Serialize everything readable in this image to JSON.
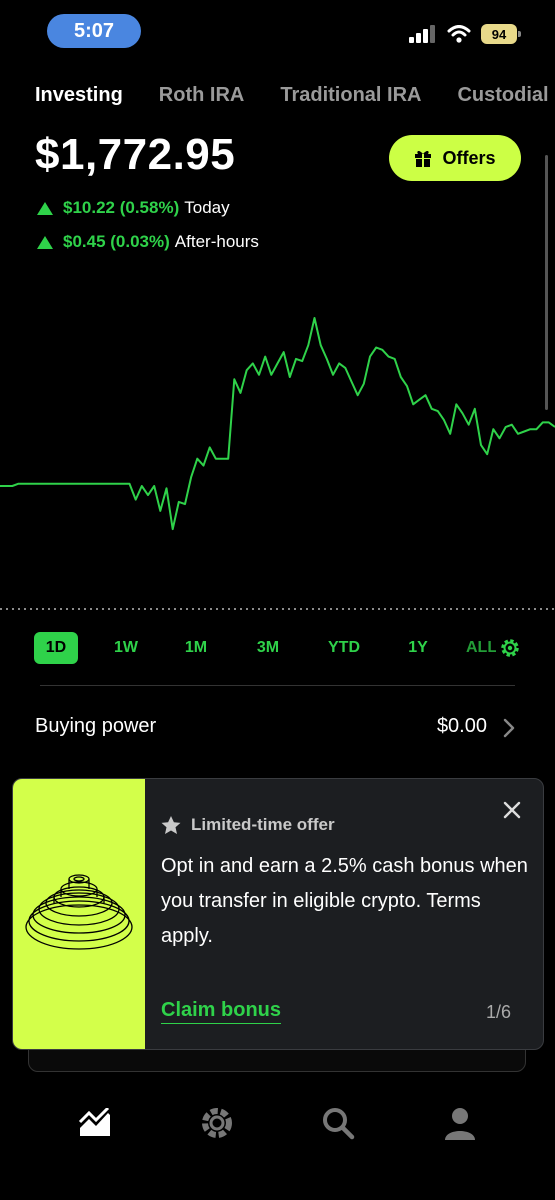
{
  "status": {
    "time": "5:07",
    "battery": "94"
  },
  "tabs": [
    "Investing",
    "Roth IRA",
    "Traditional IRA",
    "Custodial"
  ],
  "portfolio": {
    "balance": "$1,772.95",
    "today_change": "$10.22 (0.58%)",
    "today_label": "Today",
    "afterhours_change": "$0.45 (0.03%)",
    "afterhours_label": "After-hours"
  },
  "offers_button": {
    "label": "Offers",
    "icon": "gift-icon"
  },
  "chart_data": {
    "type": "line",
    "color": "#2fd24a",
    "reference_line": "dotted",
    "series": [
      {
        "values": [
          0.26,
          0.26,
          0.26,
          0.27,
          0.27,
          0.27,
          0.27,
          0.27,
          0.27,
          0.27,
          0.27,
          0.27,
          0.27,
          0.27,
          0.27,
          0.27,
          0.27,
          0.27,
          0.27,
          0.27,
          0.27,
          0.27,
          0.2,
          0.26,
          0.22,
          0.26,
          0.15,
          0.25,
          0.07,
          0.19,
          0.18,
          0.3,
          0.38,
          0.35,
          0.43,
          0.38,
          0.38,
          0.38,
          0.73,
          0.67,
          0.77,
          0.8,
          0.75,
          0.83,
          0.75,
          0.8,
          0.85,
          0.74,
          0.82,
          0.81,
          0.88,
          1.0,
          0.88,
          0.82,
          0.75,
          0.8,
          0.78,
          0.72,
          0.66,
          0.71,
          0.83,
          0.87,
          0.86,
          0.83,
          0.82,
          0.74,
          0.7,
          0.62,
          0.64,
          0.66,
          0.6,
          0.59,
          0.55,
          0.49,
          0.62,
          0.58,
          0.53,
          0.6,
          0.44,
          0.4,
          0.51,
          0.47,
          0.52,
          0.53,
          0.49,
          0.5,
          0.51,
          0.51,
          0.54,
          0.54,
          0.52
        ]
      }
    ]
  },
  "ranges": {
    "items": [
      "1D",
      "1W",
      "1M",
      "3M",
      "YTD",
      "1Y",
      "ALL"
    ],
    "selected": "1D",
    "settings_icon": "gear-icon"
  },
  "buying_power": {
    "label": "Buying power",
    "value": "$0.00"
  },
  "promo": {
    "tag": "Limited-time offer",
    "body": "Opt in and earn a 2.5% cash bonus when you transfer in eligible crypto. Terms apply.",
    "cta": "Claim bonus",
    "page": "1/6",
    "accent": "#d3ff4a"
  },
  "nav": [
    "investing-icon",
    "crypto-icon",
    "search-icon",
    "account-icon"
  ]
}
